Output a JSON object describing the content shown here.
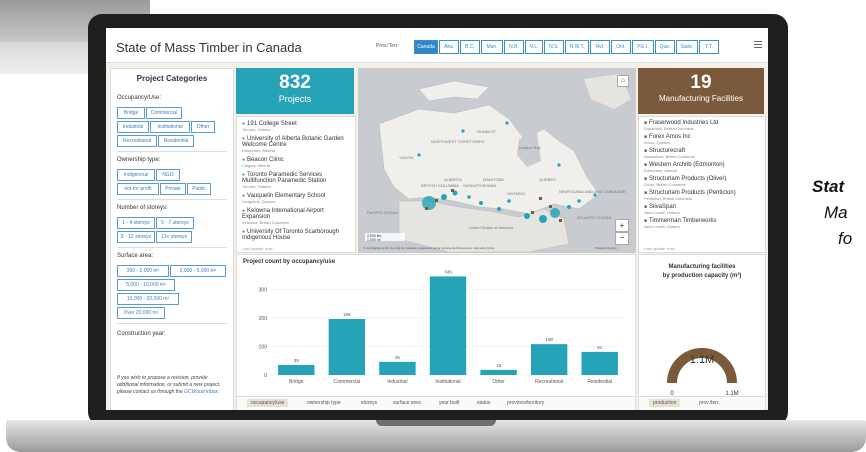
{
  "app": {
    "title": "State of Mass Timber in Canada"
  },
  "provinces": {
    "label": "Prov./Terr.",
    "items": [
      "Canada",
      "Alta.",
      "B.C.",
      "Man.",
      "N.B.",
      "N.L.",
      "N.S.",
      "N.W.T.",
      "Nvt.",
      "Ont.",
      "P.E.I.",
      "Que.",
      "Sask.",
      "Y.T."
    ],
    "selected": "Canada"
  },
  "left_panel": {
    "title": "Project Categories",
    "occupancy": {
      "label": "Occupancy/Use:",
      "tags": [
        "Bridge",
        "Commercial",
        "Industrial",
        "Institutional",
        "Other",
        "Recreational",
        "Residential"
      ]
    },
    "ownership": {
      "label": "Ownership type:",
      "tags": [
        "Indigenous",
        "NGO",
        "not-for-profit",
        "Private",
        "Public"
      ]
    },
    "storeys": {
      "label": "Number of storeys:",
      "tags": [
        "1 - 4 storeys",
        "5 - 7 storeys",
        "8 - 12 storeys",
        "13+ storeys"
      ]
    },
    "surface": {
      "label": "Surface area:",
      "tags": [
        "300 - 2,000 m²",
        "2,000 - 5,000 m²",
        "5,000 - 10,000 m²",
        "10,000 - 20,000 m²",
        "Over 20,000 m²"
      ]
    },
    "construction_year": {
      "label": "Construction year:"
    },
    "note": "If you wish to propose a revision, provide additional information, or submit a new project, please contact us through the",
    "note_link": "GCWood inbox."
  },
  "projects": {
    "count": "832",
    "label": "Projects",
    "items": [
      {
        "name": "191 College Street",
        "location": "Toronto, Ontario"
      },
      {
        "name": "University of Alberta Botanic Garden Welcome Centre",
        "location": "Edmonton, Alberta"
      },
      {
        "name": "Beacon Clinic",
        "location": "Calgary, Alberta"
      },
      {
        "name": "Toronto Paramedic Services Multifunction Paramedic Station",
        "location": "Toronto, Ontario"
      },
      {
        "name": "Vauquelin Elementary School",
        "location": "Longueuil, Quebec"
      },
      {
        "name": "Kelowna International Airport Expansion",
        "location": "Kelowna, British Columbia"
      },
      {
        "name": "University Of Toronto Scarborough Indigenous House",
        "location": ""
      }
    ],
    "footer": "Last update: now"
  },
  "map": {
    "labels": {
      "nunavut": "NUNAVUT",
      "nwt": "NORTHWEST TERRITORIES",
      "yukon": "YUKON",
      "bc": "BRITISH COLUMBIA",
      "alberta": "ALBERTA",
      "sask": "SASKATCHEWAN",
      "manitoba": "MANITOBA",
      "ontario": "ONTARIO",
      "quebec": "QUEBEC",
      "nl": "NEWFOUNDLAND AND LABRADOR",
      "hudson": "Hudson Bay",
      "us": "United States of America",
      "pacific": "PACIFIC OCEAN",
      "atlantic": "ATLANTIC OCEAN"
    },
    "scale_km": "2,000 km",
    "scale_mi": "1,000 mi",
    "attribution": "© Sa Majesté le Roi du chef du Canada, représenté par le ministre de Ressources naturelles Cana...",
    "powered": "Powered by Esri",
    "zoom_in": "+",
    "zoom_out": "−"
  },
  "manufacturing": {
    "count": "19",
    "label": "Manufacturing Facilities",
    "items": [
      {
        "name": "Fraserwood Industries Ltd",
        "location": "Squamish, British Columbia"
      },
      {
        "name": "Forex Amos Inc",
        "location": "Amos, Quebec"
      },
      {
        "name": "Structurecraft",
        "location": "Abbotsford, British Columbia"
      },
      {
        "name": "Western Archrib (Edmonton)",
        "location": "Edmonton, Alberta"
      },
      {
        "name": "Structurlam Products (Oliver)",
        "location": "Oliver, British Columbia"
      },
      {
        "name": "Structurlam Products (Penticton)",
        "location": "Penticton, British Columbia"
      },
      {
        "name": "SilvaSpan",
        "location": "New Lowell, Ontario"
      },
      {
        "name": "Timmerman Timberworks",
        "location": "New Lowell, Ontario"
      }
    ],
    "footer": "Last update: now"
  },
  "chart_data": {
    "type": "bar",
    "title": "Project count by occupancy/use",
    "categories": [
      "Bridge",
      "Commercial",
      "Industrial",
      "Institutional",
      "Other",
      "Recreational",
      "Residential"
    ],
    "values": [
      35,
      196,
      46,
      345,
      18,
      108,
      81
    ],
    "ylim": [
      0,
      350
    ],
    "yticks": [
      0,
      100,
      200,
      300
    ],
    "color": "#27a3b7",
    "tabs": [
      "occupancy/use",
      "ownership type",
      "storeys",
      "surface area",
      "year built",
      "status",
      "province/territory"
    ],
    "active_tab": "occupancy/use"
  },
  "gauge": {
    "title": "Manufacturing facilities",
    "subtitle": "by production capacity (m³)",
    "value_label": "1.1M",
    "min_label": "0",
    "max_label": "1.1M",
    "fill_fraction": 1.0,
    "color": "#7b5a3c",
    "tabs": [
      "production",
      "prov./terr."
    ],
    "active_tab": "production"
  },
  "caption": {
    "line1": "Stat",
    "line2": "Ma",
    "line3": "fo"
  }
}
